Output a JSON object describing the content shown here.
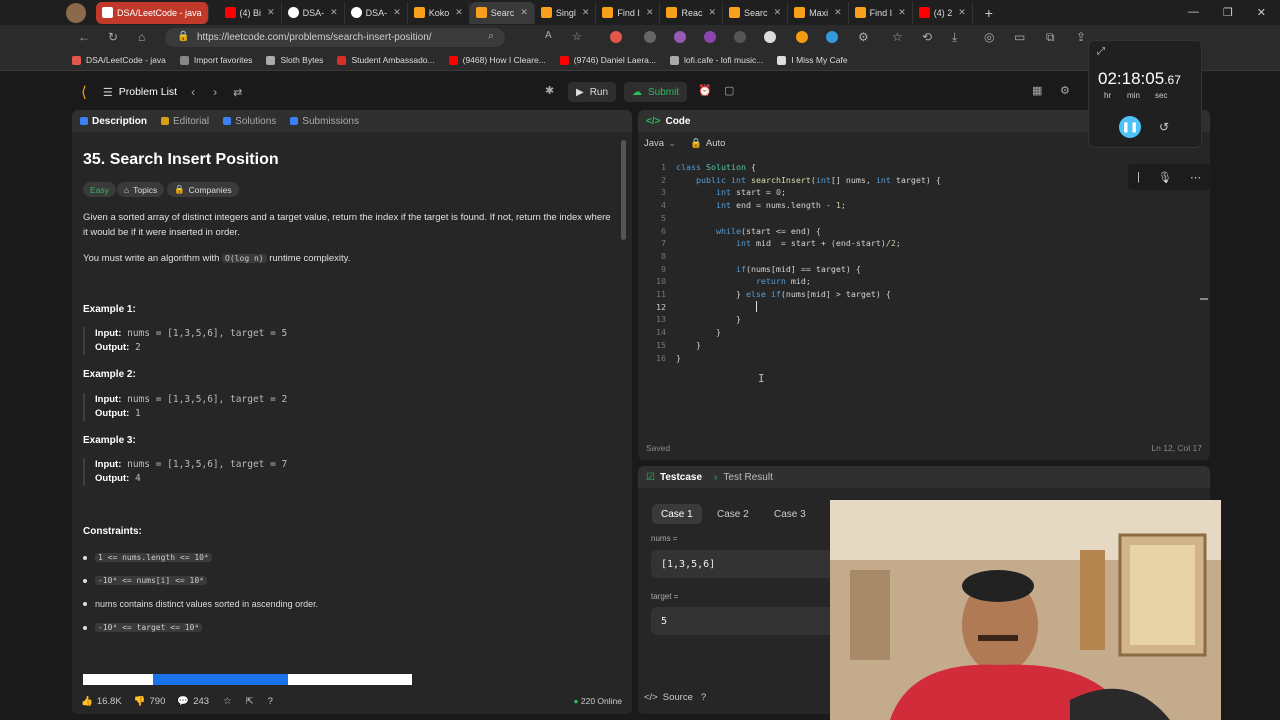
{
  "browser": {
    "tabs": [
      {
        "label": "DSA/LeetCode - java",
        "color": "#e2574c"
      },
      {
        "label": "(4) Bi",
        "color": "#ff0000"
      },
      {
        "label": "DSA-",
        "color": "#ffffff"
      },
      {
        "label": "DSA-",
        "color": "#ffffff"
      },
      {
        "label": "Koko",
        "color": "#f89f1b"
      },
      {
        "label": "Searc",
        "color": "#f89f1b"
      },
      {
        "label": "Singl",
        "color": "#f89f1b"
      },
      {
        "label": "Find I",
        "color": "#f89f1b"
      },
      {
        "label": "Reac",
        "color": "#f89f1b"
      },
      {
        "label": "Searc",
        "color": "#f89f1b"
      },
      {
        "label": "Maxi",
        "color": "#f89f1b"
      },
      {
        "label": "Find I",
        "color": "#f89f1b"
      },
      {
        "label": "(4) 2",
        "color": "#ff0000"
      }
    ],
    "url": "https://leetcode.com/problems/search-insert-position/",
    "bookmarks": [
      {
        "label": "DSA/LeetCode - java",
        "color": "#e2574c"
      },
      {
        "label": "Import favorites",
        "color": "#888888"
      },
      {
        "label": "Sloth Bytes",
        "color": "#aaaaaa"
      },
      {
        "label": "Student Ambassado...",
        "color": "#d93025"
      },
      {
        "label": "(9468) How I Cleare...",
        "color": "#ff0000"
      },
      {
        "label": "(9746) Daniel Laera...",
        "color": "#ff0000"
      },
      {
        "label": "lofi.cafe - lofi music...",
        "color": "#aaaaaa"
      },
      {
        "label": "I Miss My Cafe",
        "color": "#dddddd"
      }
    ]
  },
  "leetcode": {
    "problem_list": "Problem List",
    "run": "Run",
    "submit": "Submit",
    "left_tabs": [
      "Description",
      "Editorial",
      "Solutions",
      "Submissions"
    ],
    "title": "35. Search Insert Position",
    "difficulty": "Easy",
    "topics": "Topics",
    "companies": "Companies",
    "description": "Given a sorted array of distinct integers and a target value, return the index if the target is found. If not, return the index where it would be if it were inserted in order.",
    "desc2_pre": "You must write an algorithm with",
    "desc2_code": "O(log n)",
    "desc2_post": "runtime complexity.",
    "examples": [
      {
        "title": "Example 1:",
        "input_label": "Input:",
        "input": "nums = [1,3,5,6], target = 5",
        "output_label": "Output:",
        "output": "2"
      },
      {
        "title": "Example 2:",
        "input_label": "Input:",
        "input": "nums = [1,3,5,6], target = 2",
        "output_label": "Output:",
        "output": "1"
      },
      {
        "title": "Example 3:",
        "input_label": "Input:",
        "input": "nums = [1,3,5,6], target = 7",
        "output_label": "Output:",
        "output": "4"
      }
    ],
    "constraints_title": "Constraints:",
    "constraints": [
      "1 <= nums.length <= 10⁴",
      "-10⁴ <= nums[i] <= 10⁴",
      "nums contains distinct values sorted in ascending order.",
      "-10⁴ <= target <= 10⁴"
    ],
    "likes": "16.8K",
    "dislikes": "790",
    "comments": "243",
    "online": "220 Online",
    "code_title": "Code",
    "language": "Java",
    "auto": "Auto",
    "code_lines": [
      "class Solution {",
      "    public int searchInsert(int[] nums, int target) {",
      "        int start = 0;",
      "        int end = nums.length - 1;",
      "",
      "        while(start <= end) {",
      "            int mid  = start + (end-start)/2;",
      "",
      "            if(nums[mid] == target) {",
      "                return mid;",
      "            } else if(nums[mid] > target) {",
      "                ",
      "            }",
      "        }",
      "    }",
      "}"
    ],
    "saved": "Saved",
    "cursor": "Ln 12, Col 17",
    "testcase": "Testcase",
    "test_result": "Test Result",
    "cases": [
      "Case 1",
      "Case 2",
      "Case 3"
    ],
    "nums_label": "nums =",
    "nums_value": "[1,3,5,6]",
    "target_label": "target =",
    "target_value": "5",
    "source": "Source"
  },
  "timer": {
    "value": "02:18:05",
    "fraction": ".67",
    "units": [
      "hr",
      "min",
      "sec"
    ]
  }
}
